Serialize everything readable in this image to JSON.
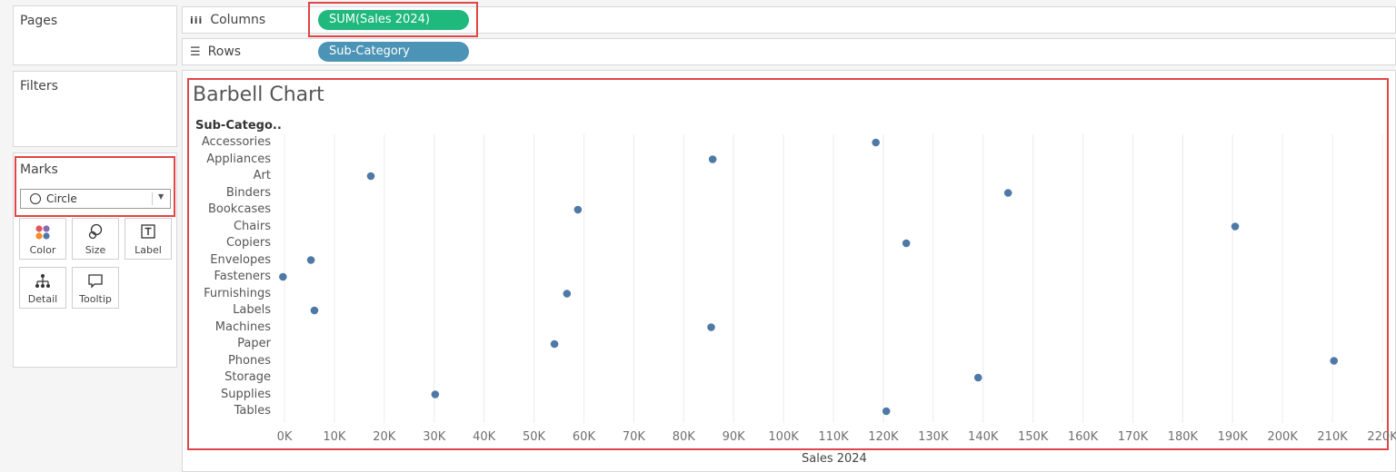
{
  "left_panel": {
    "pages_title": "Pages",
    "filters_title": "Filters",
    "marks_title": "Marks",
    "mark_type": "Circle",
    "mark_buttons": [
      {
        "label": "Color",
        "icon": "color-icon"
      },
      {
        "label": "Size",
        "icon": "size-icon"
      },
      {
        "label": "Label",
        "icon": "label-icon"
      },
      {
        "label": "Detail",
        "icon": "detail-icon"
      },
      {
        "label": "Tooltip",
        "icon": "tooltip-icon"
      }
    ]
  },
  "shelves": {
    "columns_label": "Columns",
    "columns_pill": "SUM(Sales 2024)",
    "rows_label": "Rows",
    "rows_pill": "Sub-Category"
  },
  "colors": {
    "measure_pill": "#1fb87d",
    "dimension_pill": "#4c94b6",
    "mark": "#4e79a7",
    "highlight_box": "#e04646"
  },
  "chart_data": {
    "type": "scatter",
    "title": "Barbell Chart",
    "row_header": "Sub-Catego..",
    "xlabel": "Sales 2024",
    "xlim": [
      0,
      220000
    ],
    "x_ticks": [
      "0K",
      "10K",
      "20K",
      "30K",
      "40K",
      "50K",
      "60K",
      "70K",
      "80K",
      "90K",
      "100K",
      "110K",
      "120K",
      "130K",
      "140K",
      "150K",
      "160K",
      "170K",
      "180K",
      "190K",
      "200K",
      "210K",
      "220K"
    ],
    "grid": "vertical",
    "categories": [
      "Accessories",
      "Appliances",
      "Art",
      "Binders",
      "Bookcases",
      "Chairs",
      "Copiers",
      "Envelopes",
      "Fasteners",
      "Furnishings",
      "Labels",
      "Machines",
      "Paper",
      "Phones",
      "Storage",
      "Supplies",
      "Tables"
    ],
    "values": [
      118500,
      85800,
      17300,
      145000,
      58800,
      190500,
      124600,
      5300,
      -300,
      56600,
      6000,
      85500,
      54100,
      210300,
      139000,
      30200,
      120600
    ]
  }
}
